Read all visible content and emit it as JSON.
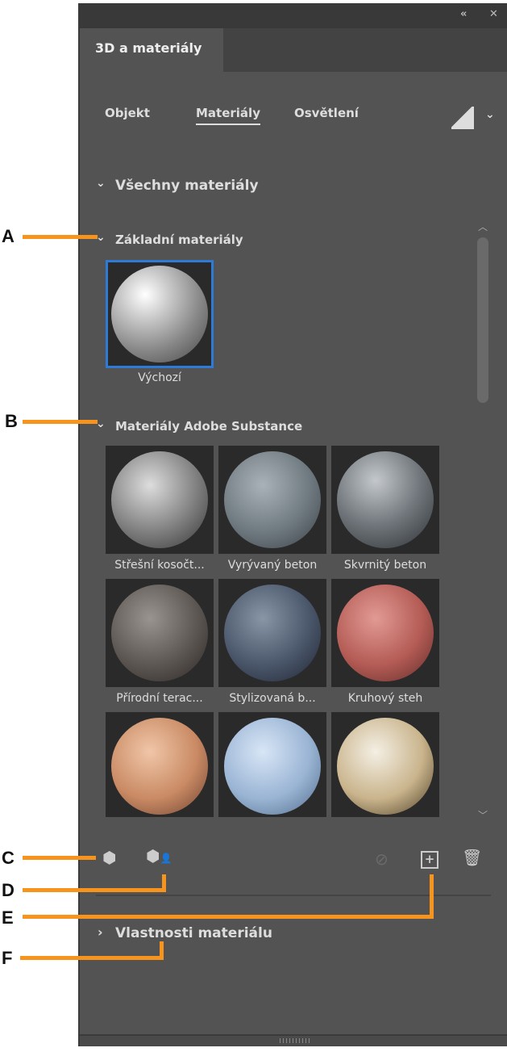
{
  "panel": {
    "title": "3D a materiály",
    "collapse_icon": "double-chevron-left",
    "close_icon": "close"
  },
  "tabs": [
    {
      "label": "Objekt"
    },
    {
      "label": "Materiály",
      "active": true
    },
    {
      "label": "Osvětlení"
    }
  ],
  "render_icon": "render-quality",
  "menu_icon": "chevron-down",
  "all_materials": "Všechny materiály",
  "basic": {
    "header": "Základní materiály",
    "items": [
      {
        "label": "Výchozí",
        "selected": true
      }
    ]
  },
  "substance": {
    "header": "Materiály Adobe Substance",
    "items": [
      {
        "label": "Střešní kosočt..."
      },
      {
        "label": "Vyrývaný beton"
      },
      {
        "label": "Skvrnitý beton"
      },
      {
        "label": "Přírodní terac..."
      },
      {
        "label": "Stylizovaná b..."
      },
      {
        "label": "Kruhový steh"
      },
      {
        "label": ""
      },
      {
        "label": ""
      },
      {
        "label": ""
      }
    ]
  },
  "properties_header": "Vlastnosti materiálu",
  "annotations": [
    "A",
    "B",
    "C",
    "D",
    "E",
    "F"
  ],
  "colors": {
    "accent": "#f7941d",
    "selection": "#2d7bd6",
    "panel": "#535353"
  }
}
